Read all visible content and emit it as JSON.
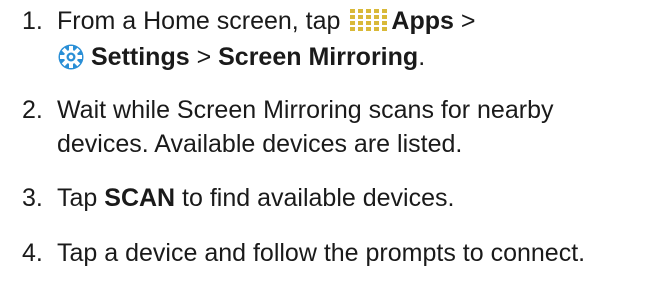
{
  "steps": [
    {
      "number": "1.",
      "line1": {
        "text_before": "From a Home screen, tap ",
        "apps_label": "Apps",
        "text_after": " >"
      },
      "line2": {
        "settings_label": "Settings",
        "separator": " > ",
        "screen_mirroring_label": "Screen Mirroring",
        "end": "."
      }
    },
    {
      "number": "2.",
      "line1": "Wait while Screen Mirroring scans for nearby",
      "line2": "devices. Available devices are listed."
    },
    {
      "number": "3.",
      "text_before": "Tap ",
      "scan_label": "SCAN",
      "text_after": " to find available devices."
    },
    {
      "number": "4.",
      "text": "Tap a device and follow the prompts to connect."
    }
  ],
  "icons": {
    "apps": "apps-grid-icon",
    "settings": "settings-gear-icon"
  },
  "colors": {
    "text": "#1a1a1a",
    "icon_blue": "#2a8fd6",
    "icon_grid": "#d9b938"
  }
}
